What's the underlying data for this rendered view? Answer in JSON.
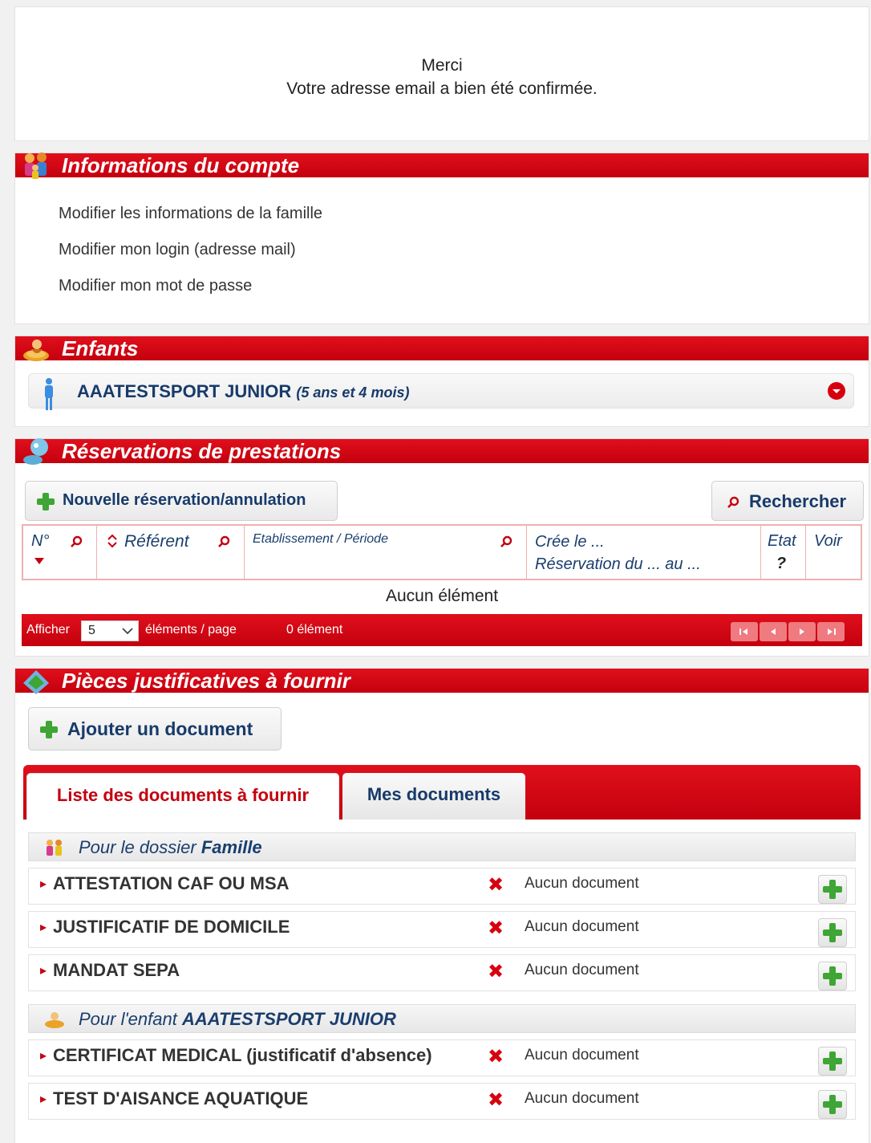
{
  "confirmation": {
    "line1": "Merci",
    "line2": "Votre adresse email a bien été confirmée."
  },
  "account": {
    "title": "Informations du compte",
    "links": [
      "Modifier les informations de la famille",
      "Modifier mon login (adresse mail)",
      "Modifier mon mot de passe"
    ]
  },
  "children": {
    "title": "Enfants",
    "child_name": "AAATESTSPORT JUNIOR",
    "child_age": "(5 ans et 4 mois)"
  },
  "reservations": {
    "title": "Réservations de prestations",
    "new_button": "Nouvelle réservation/annulation",
    "search_button": "Rechercher",
    "columns": {
      "num": "N°",
      "referent": "Référent",
      "etab": "Etablissement / Période",
      "cree_line1": "Crée le ...",
      "cree_line2": "Réservation du ... au ...",
      "etat": "Etat",
      "etat_help": "?",
      "voir": "Voir"
    },
    "empty": "Aucun élément",
    "footer": {
      "show_label": "Afficher",
      "page_size": "5",
      "per_page": "éléments / page",
      "count": "0 élément"
    }
  },
  "documents": {
    "title": "Pièces justificatives à fournir",
    "add_button": "Ajouter un document",
    "tabs": [
      "Liste des documents à fournir",
      "Mes documents"
    ],
    "family_group": {
      "prefix": "Pour le dossier ",
      "name": "Famille"
    },
    "family_docs": [
      {
        "name": "ATTESTATION CAF OU MSA",
        "status": "Aucun document"
      },
      {
        "name": "JUSTIFICATIF DE DOMICILE",
        "status": "Aucun document"
      },
      {
        "name": "MANDAT SEPA",
        "status": "Aucun document"
      }
    ],
    "child_group": {
      "prefix": "Pour l'enfant ",
      "name": "AAATESTSPORT JUNIOR"
    },
    "child_docs": [
      {
        "name": "CERTIFICAT MEDICAL (justificatif d'absence)",
        "status": "Aucun document"
      },
      {
        "name": "TEST D'AISANCE AQUATIQUE",
        "status": "Aucun document"
      }
    ]
  },
  "colors": {
    "brand_red": "#d7000f",
    "link_blue": "#173a6a",
    "plus_green": "#3fa535"
  },
  "icons": [
    "family-icon",
    "child-icon",
    "reservation-icon",
    "document-icon",
    "plus-icon",
    "search-icon",
    "red-x-icon",
    "chevron-down-icon",
    "sort-icon",
    "pager-first-icon",
    "pager-prev-icon",
    "pager-next-icon",
    "pager-last-icon"
  ]
}
